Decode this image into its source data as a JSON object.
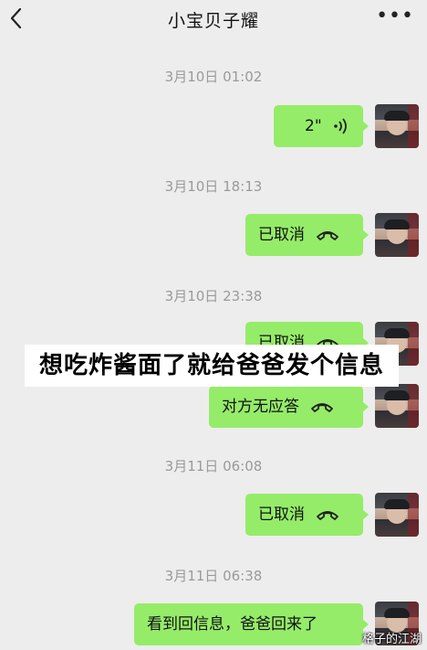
{
  "header": {
    "title": "小宝贝子耀",
    "more_label": "•••"
  },
  "messages": [
    {
      "time": "3月10日 01:02",
      "text": "2\"",
      "icon": "voice-wave-icon"
    },
    {
      "time": "3月10日 18:13",
      "text": "已取消",
      "icon": "phone-hangup-icon"
    },
    {
      "time": "3月10日 23:38",
      "text": "已取消",
      "icon": "phone-hangup-icon"
    },
    {
      "time": "",
      "text": "对方无应答",
      "icon": "phone-hangup-icon"
    },
    {
      "time": "3月11日 06:08",
      "text": "已取消",
      "icon": "phone-hangup-icon"
    },
    {
      "time": "3月11日 06:38",
      "text": "看到回信息，爸爸回来了",
      "icon": ""
    }
  ],
  "caption": "想吃炸酱面了就给爸爸发个信息",
  "watermark": "格子的江湖",
  "colors": {
    "bubble": "#95ec69",
    "background": "#ededed",
    "timestamp": "#9a9a9a"
  }
}
